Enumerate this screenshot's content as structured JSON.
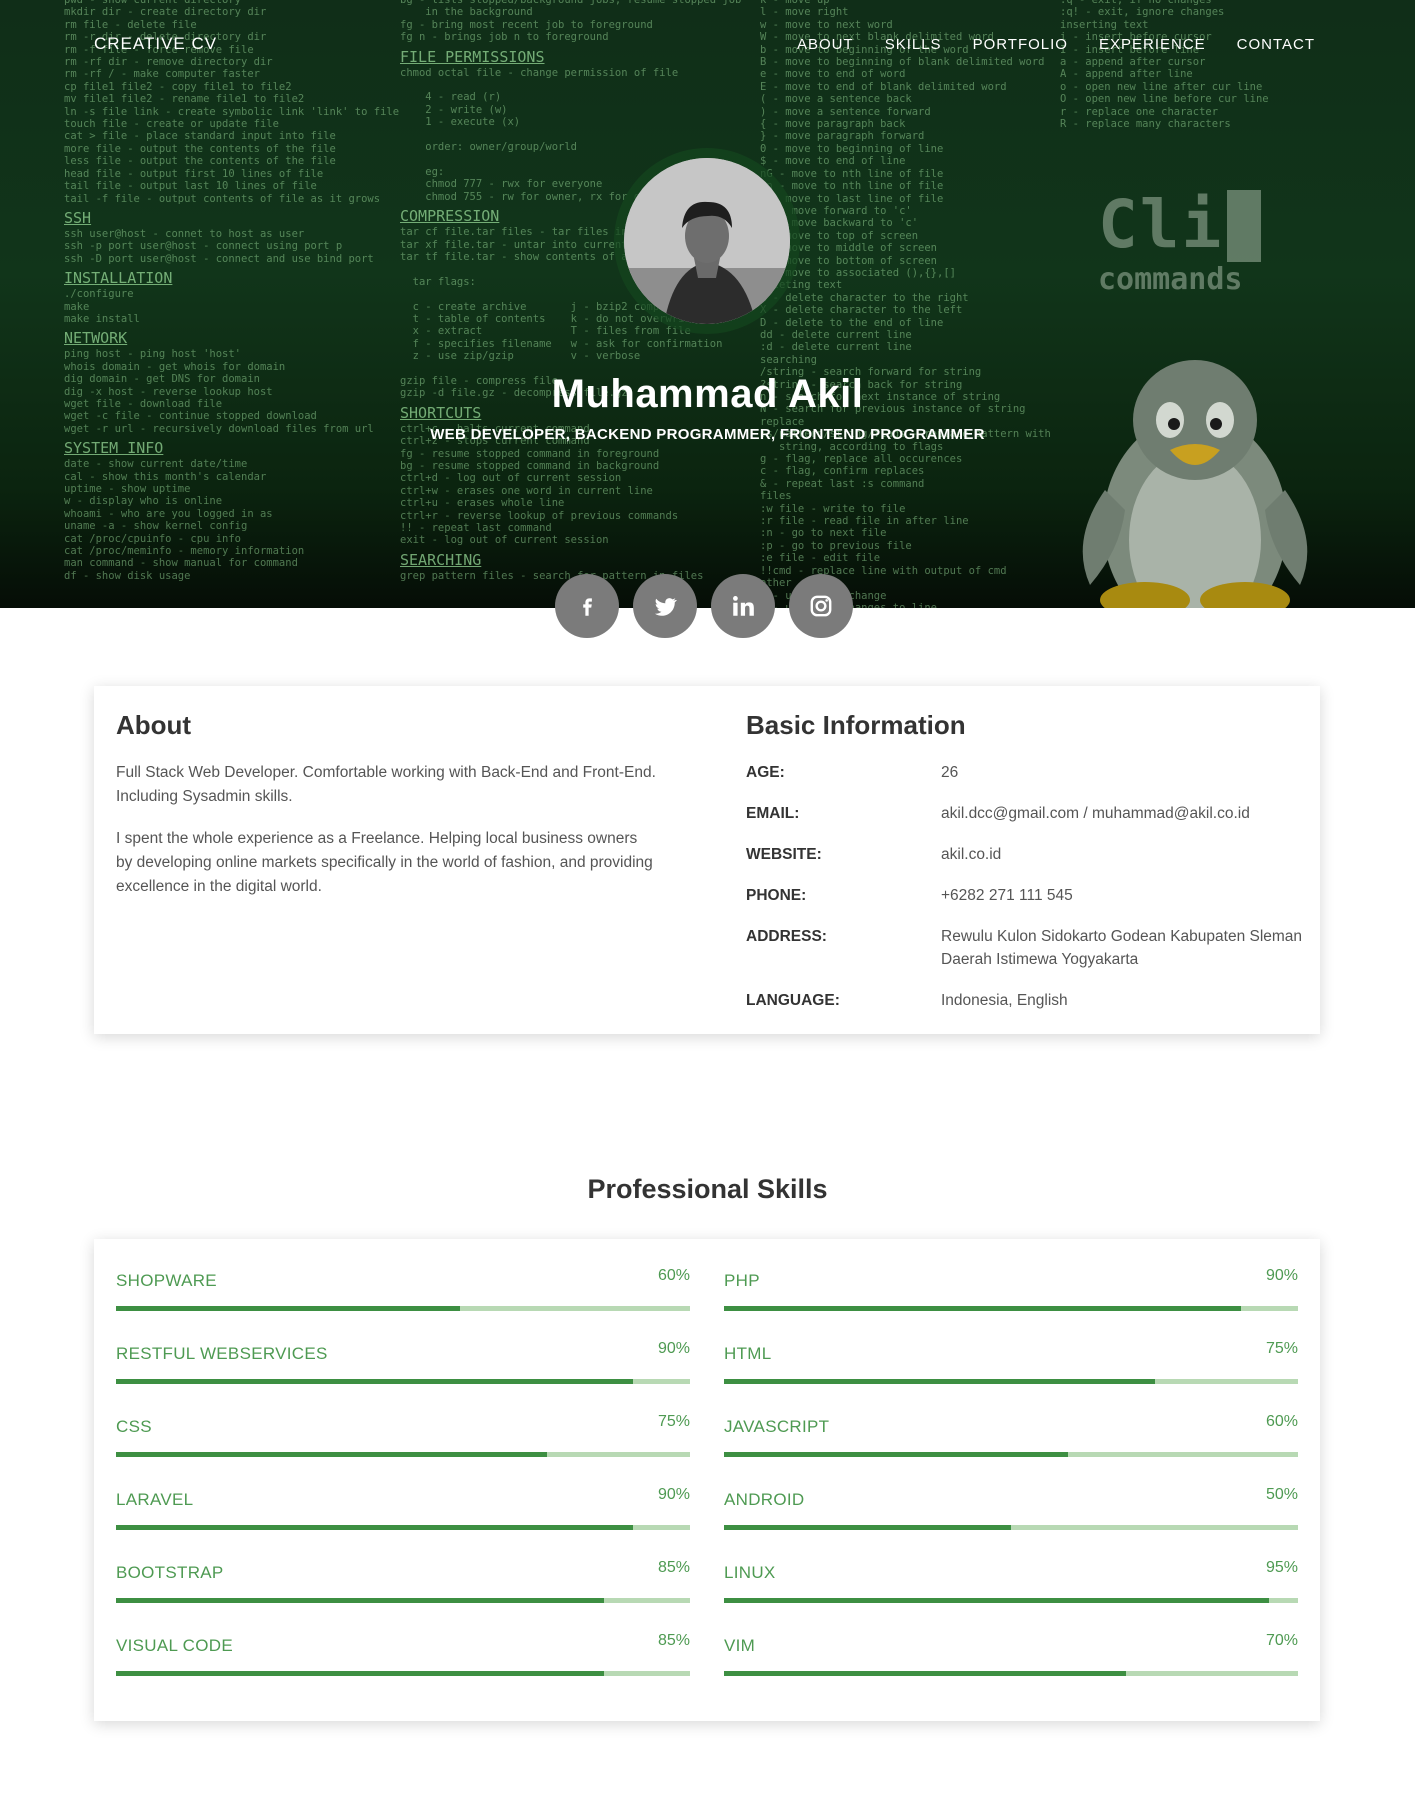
{
  "nav": {
    "brand": "CREATIVE CV",
    "links": [
      "ABOUT",
      "SKILLS",
      "PORTFOLIO",
      "EXPERIENCE",
      "CONTACT"
    ]
  },
  "hero": {
    "name": "Muhammad Akil",
    "subtitle": "WEB DEVELOPER, BACKEND PROGRAMMER, FRONTEND PROGRAMMER",
    "background_logo_big": "Cli",
    "background_logo_small": "commands",
    "socials": [
      {
        "name": "facebook",
        "glyph": "f"
      },
      {
        "name": "twitter",
        "glyph": "t"
      },
      {
        "name": "linkedin",
        "glyph": "in"
      },
      {
        "name": "instagram",
        "glyph": "ig"
      }
    ]
  },
  "about": {
    "title": "About",
    "paragraphs": [
      "Full Stack Web Developer. Comfortable working with Back-End and Front-End. Including Sysadmin skills.",
      "I spent the whole experience as a Freelance. Helping local business owners by developing online markets specifically in the world of fashion, and providing excellence in the digital world."
    ]
  },
  "basic_info": {
    "title": "Basic Information",
    "rows": [
      {
        "label": "AGE:",
        "value": "26"
      },
      {
        "label": "EMAIL:",
        "value": "akil.dcc@gmail.com / muhammad@akil.co.id"
      },
      {
        "label": "WEBSITE:",
        "value": "akil.co.id"
      },
      {
        "label": "PHONE:",
        "value": "+6282 271 111 545"
      },
      {
        "label": "ADDRESS:",
        "value": "Rewulu Kulon Sidokarto Godean Kabupaten Sleman Daerah Istimewa Yogyakarta"
      },
      {
        "label": "LANGUAGE:",
        "value": "Indonesia, English"
      }
    ]
  },
  "skills": {
    "title": "Professional Skills",
    "items": [
      {
        "name": "SHOPWARE",
        "percent": "60%",
        "level": 60
      },
      {
        "name": "PHP",
        "percent": "90%",
        "level": 90
      },
      {
        "name": "RESTFUL WEBSERVICES",
        "percent": "90%",
        "level": 90
      },
      {
        "name": "HTML",
        "percent": "75%",
        "level": 75
      },
      {
        "name": "CSS",
        "percent": "75%",
        "level": 75
      },
      {
        "name": "JAVASCRIPT",
        "percent": "60%",
        "level": 60
      },
      {
        "name": "LARAVEL",
        "percent": "90%",
        "level": 90
      },
      {
        "name": "ANDROID",
        "percent": "50%",
        "level": 50
      },
      {
        "name": "BOOTSTRAP",
        "percent": "85%",
        "level": 85
      },
      {
        "name": "LINUX",
        "percent": "95%",
        "level": 95
      },
      {
        "name": "VISUAL CODE",
        "percent": "85%",
        "level": 85
      },
      {
        "name": "VIM",
        "percent": "70%",
        "level": 70
      }
    ]
  },
  "colors": {
    "accent": "#4e9a52",
    "bar_fill": "#3d8f42",
    "bar_track": "#b8d9b4",
    "hero_bg": "#11351a",
    "social_bg": "#7b7b7b"
  }
}
